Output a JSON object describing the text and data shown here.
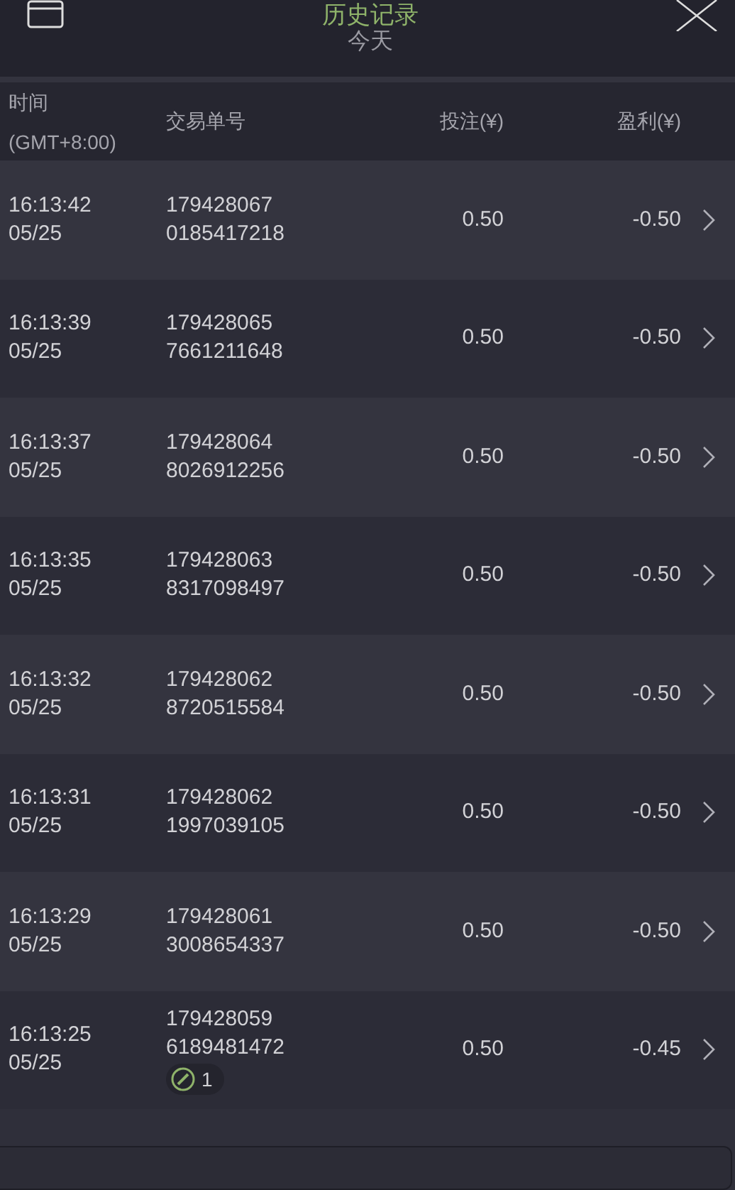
{
  "header": {
    "title": "历史记录",
    "subtitle": "今天"
  },
  "columns": [
    {
      "line1": "时间",
      "line2": "(GMT+8:00)"
    },
    {
      "line1": "交易单号"
    },
    {
      "line1": "投注(¥)"
    },
    {
      "line1": "盈利(¥)"
    }
  ],
  "rows": [
    {
      "time": "16:13:42",
      "date": "05/25",
      "id1": "179428067",
      "id2": "0185417218",
      "stake": "0.50",
      "profit": "-0.50"
    },
    {
      "time": "16:13:39",
      "date": "05/25",
      "id1": "179428065",
      "id2": "7661211648",
      "stake": "0.50",
      "profit": "-0.50"
    },
    {
      "time": "16:13:37",
      "date": "05/25",
      "id1": "179428064",
      "id2": "8026912256",
      "stake": "0.50",
      "profit": "-0.50"
    },
    {
      "time": "16:13:35",
      "date": "05/25",
      "id1": "179428063",
      "id2": "8317098497",
      "stake": "0.50",
      "profit": "-0.50"
    },
    {
      "time": "16:13:32",
      "date": "05/25",
      "id1": "179428062",
      "id2": "8720515584",
      "stake": "0.50",
      "profit": "-0.50"
    },
    {
      "time": "16:13:31",
      "date": "05/25",
      "id1": "179428062",
      "id2": "1997039105",
      "stake": "0.50",
      "profit": "-0.50"
    },
    {
      "time": "16:13:29",
      "date": "05/25",
      "id1": "179428061",
      "id2": "3008654337",
      "stake": "0.50",
      "profit": "-0.50"
    },
    {
      "time": "16:13:25",
      "date": "05/25",
      "id1": "179428059",
      "id2": "6189481472",
      "badge": "1",
      "stake": "0.50",
      "profit": "-0.45"
    }
  ]
}
